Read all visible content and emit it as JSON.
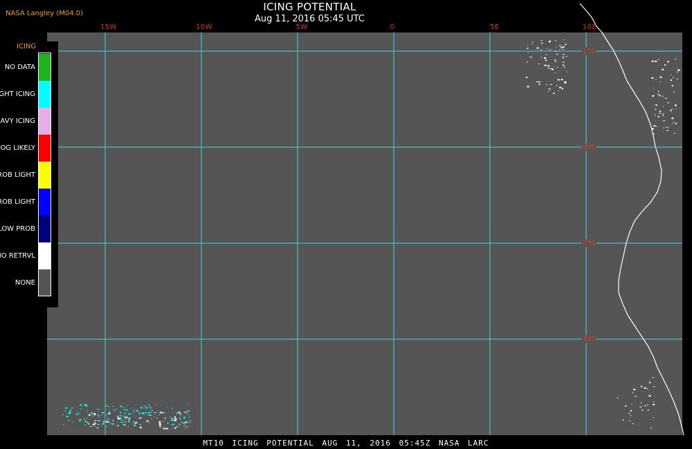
{
  "header": {
    "credit": "NASA Langley (M04.0)",
    "title": "ICING POTENTIAL",
    "subtitle": "Aug 11, 2016 05:45 UTC"
  },
  "map": {
    "background": "#555555",
    "grid_color": "#3fd9d9",
    "coast_color": "#ffffff",
    "label_color": "#d43a2a",
    "lon_labels": [
      "15W",
      "10W",
      "5W",
      "0",
      "5E",
      "10E"
    ],
    "lat_labels": [
      "15S",
      "20S",
      "25S",
      "30S"
    ]
  },
  "legend": {
    "heading": "ICING",
    "items": [
      {
        "label": "NO DATA",
        "color": "#1db41d"
      },
      {
        "label": "NIGHT ICING",
        "color": "#00ffff"
      },
      {
        "label": "HEAVY ICING",
        "color": "#e6aee6"
      },
      {
        "label": "MOG LIKELY",
        "color": "#ff0000"
      },
      {
        "label": "HI PROB LIGHT",
        "color": "#ffff00"
      },
      {
        "label": "MED PROB LIGHT",
        "color": "#0000ff"
      },
      {
        "label": "LOW PROB",
        "color": "#00007f"
      },
      {
        "label": "NO RETRVL",
        "color": "#ffffff"
      },
      {
        "label": "NONE",
        "color": "#555555"
      }
    ]
  },
  "footer": {
    "text": "MT10   ICING POTENTIAL   AUG 11, 2016 05:45Z   NASA LARC"
  }
}
